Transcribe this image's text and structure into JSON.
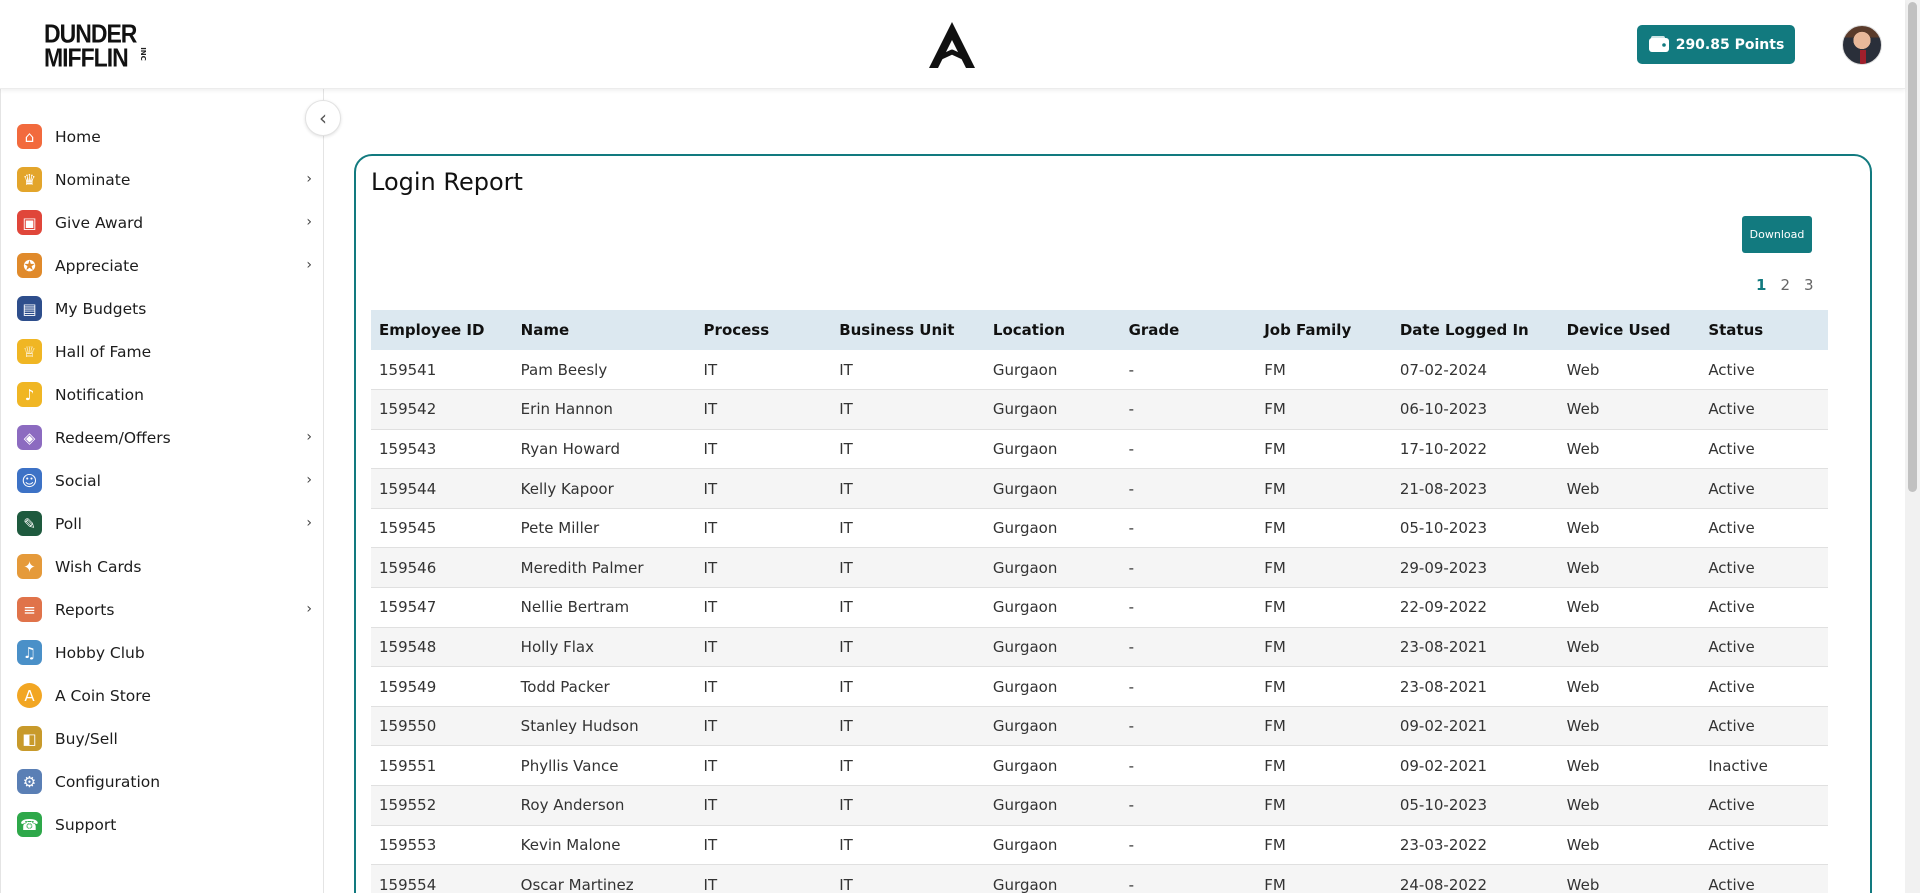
{
  "brand": {
    "line1": "DUNDER",
    "line2": "MIFFLIN",
    "suffix": "INC"
  },
  "header": {
    "points_label": "290.85  Points"
  },
  "sidebar": {
    "items": [
      {
        "label": "Home",
        "icon": "home-icon",
        "color": "#f26a3d",
        "chevron": false
      },
      {
        "label": "Nominate",
        "icon": "trophy-icon",
        "color": "#e3a52b",
        "chevron": true
      },
      {
        "label": "Give Award",
        "icon": "gift-icon",
        "color": "#e0463a",
        "chevron": true
      },
      {
        "label": "Appreciate",
        "icon": "badge-icon",
        "color": "#e08a2b",
        "chevron": true
      },
      {
        "label": "My Budgets",
        "icon": "wallet-icon",
        "color": "#2e4e8c",
        "chevron": false
      },
      {
        "label": "Hall of Fame",
        "icon": "crown-icon",
        "color": "#f0b624",
        "chevron": false
      },
      {
        "label": "Notification",
        "icon": "bell-icon",
        "color": "#f0b624",
        "chevron": false
      },
      {
        "label": "Redeem/Offers",
        "icon": "coupon-icon",
        "color": "#8c6bc0",
        "chevron": true
      },
      {
        "label": "Social",
        "icon": "social-icon",
        "color": "#3d72c6",
        "chevron": true
      },
      {
        "label": "Poll",
        "icon": "poll-icon",
        "color": "#1e5a3e",
        "chevron": true
      },
      {
        "label": "Wish Cards",
        "icon": "party-icon",
        "color": "#e59a3a",
        "chevron": false
      },
      {
        "label": "Reports",
        "icon": "report-icon",
        "color": "#e0734a",
        "chevron": true
      },
      {
        "label": "Hobby Club",
        "icon": "hobby-icon",
        "color": "#4a90c8",
        "chevron": false
      },
      {
        "label": "A Coin Store",
        "icon": "coin-icon",
        "color": "#f2a623",
        "chevron": false
      },
      {
        "label": "Buy/Sell",
        "icon": "shopping-icon",
        "color": "#c89a2b",
        "chevron": false
      },
      {
        "label": "Configuration",
        "icon": "config-icon",
        "color": "#5a7fb5",
        "chevron": false
      },
      {
        "label": "Support",
        "icon": "phone-icon",
        "color": "#2ea84a",
        "chevron": false
      }
    ]
  },
  "report": {
    "title": "Login Report",
    "download_label": "Download",
    "pages": [
      "1",
      "2",
      "3"
    ],
    "columns": [
      "Employee ID",
      "Name",
      "Process",
      "Business Unit",
      "Location",
      "Grade",
      "Job Family",
      "Date Logged In",
      "Device Used",
      "Status"
    ],
    "rows": [
      [
        "159541",
        "Pam Beesly",
        "IT",
        "IT",
        "Gurgaon",
        "-",
        "FM",
        "07-02-2024",
        "Web",
        "Active"
      ],
      [
        "159542",
        "Erin Hannon",
        "IT",
        "IT",
        "Gurgaon",
        "-",
        "FM",
        "06-10-2023",
        "Web",
        "Active"
      ],
      [
        "159543",
        "Ryan Howard",
        "IT",
        "IT",
        "Gurgaon",
        "-",
        "FM",
        "17-10-2022",
        "Web",
        "Active"
      ],
      [
        "159544",
        "Kelly Kapoor",
        "IT",
        "IT",
        "Gurgaon",
        "-",
        "FM",
        "21-08-2023",
        "Web",
        "Active"
      ],
      [
        "159545",
        "Pete Miller",
        "IT",
        "IT",
        "Gurgaon",
        "-",
        "FM",
        "05-10-2023",
        "Web",
        "Active"
      ],
      [
        "159546",
        "Meredith Palmer",
        "IT",
        "IT",
        "Gurgaon",
        "-",
        "FM",
        "29-09-2023",
        "Web",
        "Active"
      ],
      [
        "159547",
        "Nellie Bertram",
        "IT",
        "IT",
        "Gurgaon",
        "-",
        "FM",
        "22-09-2022",
        "Web",
        "Active"
      ],
      [
        "159548",
        "Holly Flax",
        "IT",
        "IT",
        "Gurgaon",
        "-",
        "FM",
        "23-08-2021",
        "Web",
        "Active"
      ],
      [
        "159549",
        "Todd Packer",
        "IT",
        "IT",
        "Gurgaon",
        "-",
        "FM",
        "23-08-2021",
        "Web",
        "Active"
      ],
      [
        "159550",
        "Stanley Hudson",
        "IT",
        "IT",
        "Gurgaon",
        "-",
        "FM",
        "09-02-2021",
        "Web",
        "Active"
      ],
      [
        "159551",
        "Phyllis Vance",
        "IT",
        "IT",
        "Gurgaon",
        "-",
        "FM",
        "09-02-2021",
        "Web",
        "Inactive"
      ],
      [
        "159552",
        "Roy Anderson",
        "IT",
        "IT",
        "Gurgaon",
        "-",
        "FM",
        "05-10-2023",
        "Web",
        "Active"
      ],
      [
        "159553",
        "Kevin Malone",
        "IT",
        "IT",
        "Gurgaon",
        "-",
        "FM",
        "23-03-2022",
        "Web",
        "Active"
      ],
      [
        "159554",
        "Oscar Martinez",
        "IT",
        "IT",
        "Gurgaon",
        "-",
        "FM",
        "24-08-2022",
        "Web",
        "Active"
      ]
    ]
  },
  "colors": {
    "accent": "#127a7f",
    "table_header": "#dce8f0"
  }
}
